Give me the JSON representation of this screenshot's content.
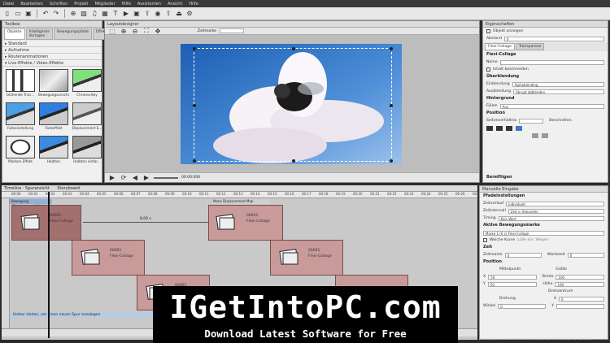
{
  "menubar": {
    "items": [
      "Datei",
      "Bearbeiten",
      "Schriften",
      "Projekt",
      "Mitglieder",
      "Hilfe",
      "Assistenten",
      "Ansicht",
      "Hilfe"
    ]
  },
  "toolbox": {
    "title": "Toolbox",
    "tabs": [
      "Objekte",
      "Intelligente Vorlagen",
      "Bewegungspfade",
      "Effekte"
    ],
    "categories": [
      "Standard",
      "Aufnahme",
      "Routenanimationen",
      "Live-Effekte / Video-Effekte"
    ],
    "effects": [
      {
        "label": "Glühende Tran..."
      },
      {
        "label": "Bewegungsunschärfe"
      },
      {
        "label": "Chroma-Key"
      },
      {
        "label": "Farbeinstellung"
      },
      {
        "label": "Farbeffekt"
      },
      {
        "label": "Displacement E..."
      },
      {
        "label": "Madsen Effekt"
      },
      {
        "label": "Halbton"
      },
      {
        "label": "Halbton einfar..."
      }
    ]
  },
  "preview": {
    "title": "Layoutdesigner",
    "zoom_label": "Zeitmarke",
    "timecode": "00:00:000"
  },
  "properties": {
    "title": "Eigenschaften",
    "show_object": "Objekt anzeigen",
    "distance_label": "Abstand",
    "distance_value": "0",
    "tabs": [
      "Flexi-Collage",
      "Transparenz"
    ],
    "flexi_header": "Flexi-Collage",
    "name_label": "Name",
    "content_label": "Inhalt beschneiden",
    "overlap_section": "Überblendung",
    "fade_in_label": "Einblendung",
    "fade_in_value": "Alphablending",
    "fade_out_label": "Ausblendung",
    "fade_out_value": "Abrupt abblenden",
    "background_section": "Hintergrund",
    "fill_label": "Füllen",
    "fill_value": "Aus",
    "position_section": "Position",
    "aspect_label": "Seitenverhältnis",
    "more_label": "Beschnitten",
    "bottom_section": "Bereiftigen"
  },
  "timeline": {
    "title": "Timeline · Spuransicht",
    "storyboard": "Storyboard",
    "ruler_ticks": [
      "00:00",
      "00:01",
      "00:02",
      "00:03",
      "00:04",
      "00:05",
      "00:06",
      "00:07",
      "00:08",
      "00:09",
      "00:10",
      "00:11",
      "00:12",
      "00:13",
      "00:14",
      "00:15",
      "00:16",
      "00:17",
      "00:18",
      "00:19",
      "00:20",
      "00:21",
      "00:22",
      "00:23",
      "00:24",
      "00:25",
      "00:26",
      "00:27"
    ],
    "motion_label": "Bewegung (Displacement Map)",
    "motion_label2": "Mono Displacement Map",
    "duration_label": "8,00 s",
    "clips": [
      {
        "id": "00001",
        "name": "Flexi-Collage"
      },
      {
        "id": "00001",
        "name": "Flexi-Collage"
      },
      {
        "id": "00001",
        "name": "Flexi-Collage"
      },
      {
        "id": "00001",
        "name": "Flexi-Collage"
      },
      {
        "id": "00001",
        "name": "Flexi-Collage"
      }
    ],
    "hint": "Hieher ziehen, um einen neuen Spur anzulegen",
    "status": "Zoom: 27,2 s · Seitenverhältnis 16:9 · D 11,7 GB. FB 10,5 GB (5%) · 00:00:27"
  },
  "manual": {
    "title": "Manuelle Eingabe",
    "s1": "Pfadeinstellungen",
    "curve_label": "Zeitverlauf",
    "curve_value": "individuell",
    "speed_label": "Zeitintervall",
    "speed_value": "Zeit in Sekunden",
    "timing_label": "Timing",
    "timing_value": "Kein Wert",
    "s2": "Aktive Bewegungsmarke",
    "marker_value": "Marke 1 (0 s) Flexi-Collage",
    "soft_label": "Weiche Kurve",
    "soft_value": "Lülle ein: Wegen",
    "s3": "Zeit",
    "time_label": "Zeitmarke",
    "time_value": "0",
    "wait_label": "Wartezeit",
    "wait_value": "0",
    "s4": "Position",
    "mid_label": "Mittelpunkt",
    "size_label": "Größe",
    "x_label": "X",
    "x_value": "50",
    "width_label": "Breite",
    "width_value": "100",
    "y_label": "Y",
    "y_value": "50",
    "height_label": "Höhe",
    "height_value": "100",
    "rot_label": "Drehzentrum",
    "rot_value": "0",
    "turn_label": "Drehung",
    "angle_label": "Winkel",
    "angle_value": "0",
    "x2_label": "X",
    "y2_label": "Y"
  },
  "banner": {
    "title": "IGetIntoPC.com",
    "subtitle": "Download Latest Software for Free"
  },
  "colors": {
    "clip": "#c99a9a",
    "clip_selected": "#a37070",
    "sky": "#3b79c4"
  }
}
